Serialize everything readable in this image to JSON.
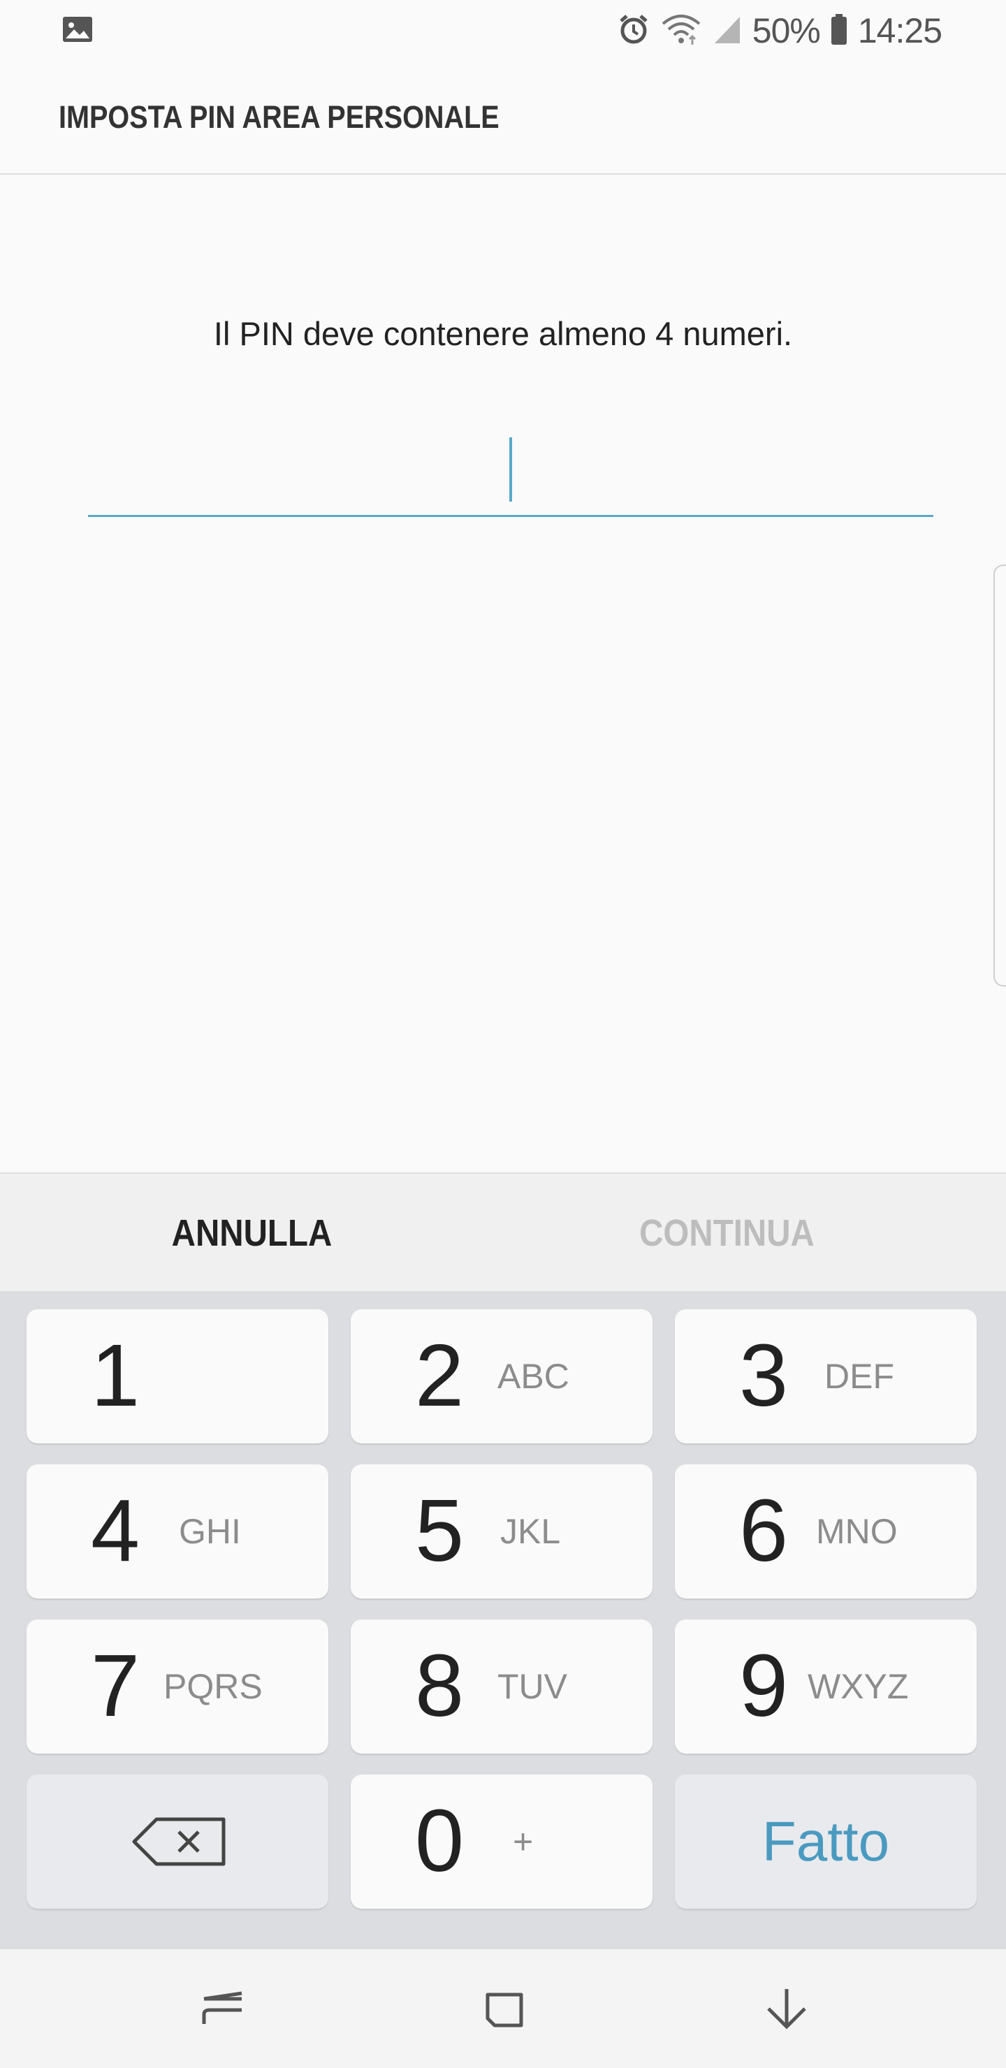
{
  "status_bar": {
    "notification_icon": "image-icon",
    "icons": [
      "alarm-icon",
      "wifi-icon",
      "signal-icon",
      "battery-icon"
    ],
    "battery": "50%",
    "time": "14:25"
  },
  "header": {
    "title": "IMPOSTA PIN AREA PERSONALE"
  },
  "main": {
    "hint": "Il PIN deve contenere almeno 4 numeri.",
    "pin_value": ""
  },
  "actions": {
    "cancel": "ANNULLA",
    "continue": "CONTINUA"
  },
  "keypad": {
    "keys": [
      {
        "digit": "1",
        "letters": ""
      },
      {
        "digit": "2",
        "letters": "ABC"
      },
      {
        "digit": "3",
        "letters": "DEF"
      },
      {
        "digit": "4",
        "letters": "GHI"
      },
      {
        "digit": "5",
        "letters": "JKL"
      },
      {
        "digit": "6",
        "letters": "MNO"
      },
      {
        "digit": "7",
        "letters": "PQRS"
      },
      {
        "digit": "8",
        "letters": "TUV"
      },
      {
        "digit": "9",
        "letters": "WXYZ"
      },
      {
        "digit": "0",
        "letters": "+"
      }
    ],
    "backspace_icon": "backspace-icon",
    "done": "Fatto"
  },
  "nav_bar": {
    "icons": [
      "recent-apps-icon",
      "home-icon",
      "back-icon"
    ]
  },
  "colors": {
    "accent": "#5aa8c8",
    "done_text": "#4a9ac0",
    "keypad_bg": "#dcdde0",
    "disabled_text": "#bdbdbd"
  }
}
